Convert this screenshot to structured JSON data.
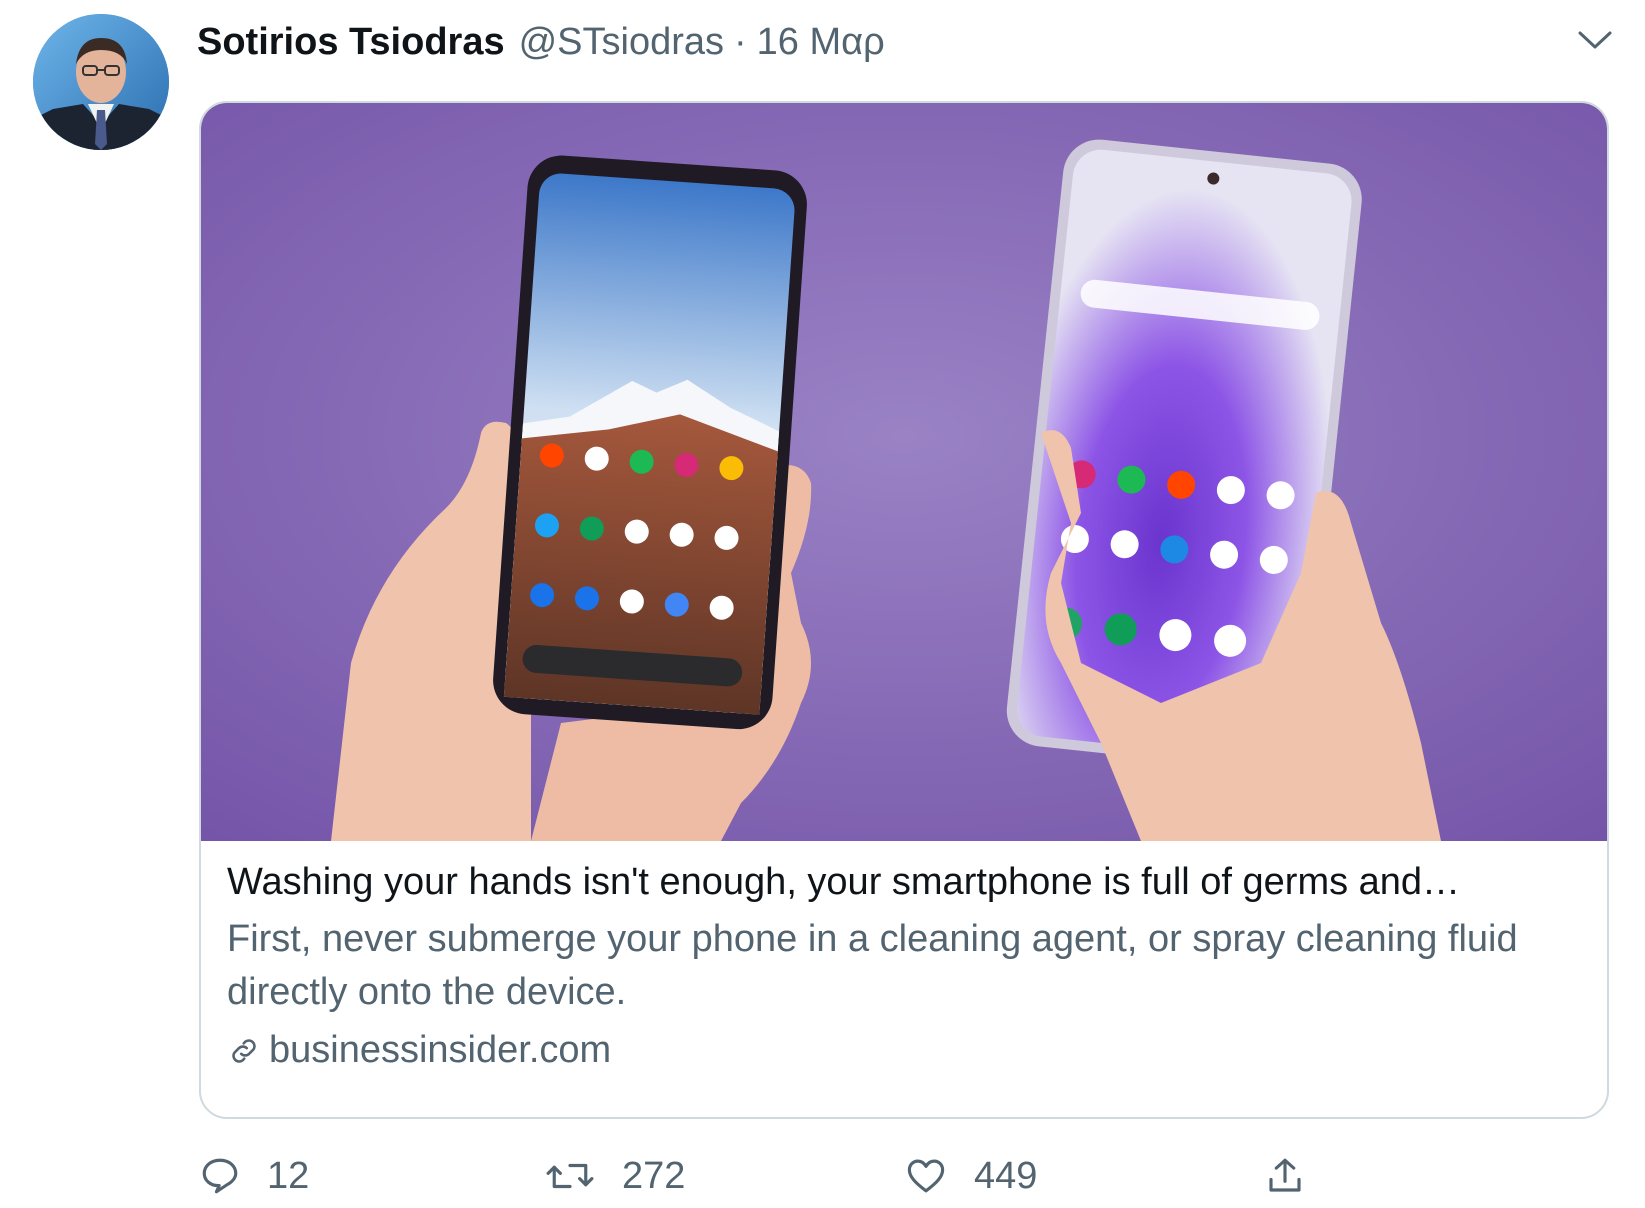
{
  "tweet": {
    "author_name": "Sotirios Tsiodras",
    "author_handle": "@STsiodras",
    "separator": "·",
    "date": "16 Μαρ",
    "card": {
      "title": "Washing your hands isn't enough, your smartphone is full of germs and…",
      "description": "First, never submerge your phone in a cleaning agent, or spray cleaning fluid directly onto the device.",
      "domain": "businessinsider.com"
    },
    "actions": {
      "replies": "12",
      "retweets": "272",
      "likes": "449"
    }
  },
  "colors": {
    "text_primary": "#0f1419",
    "text_secondary": "#536471",
    "card_border": "#cfd9de",
    "image_bg": "#8a6db3"
  },
  "icons": [
    "chevron-down-icon",
    "link-icon",
    "reply-icon",
    "retweet-icon",
    "like-icon",
    "share-icon"
  ]
}
